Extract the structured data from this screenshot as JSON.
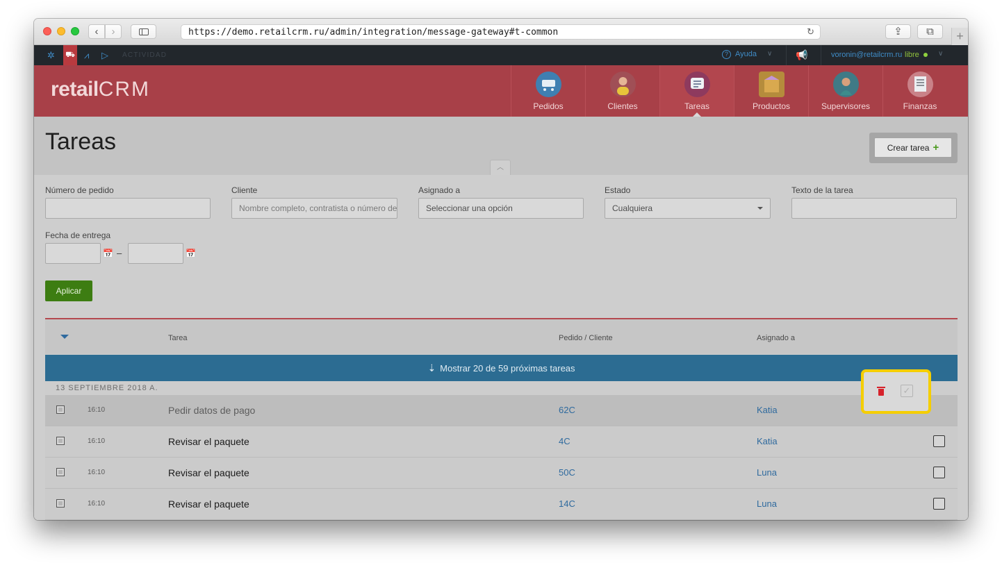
{
  "browser": {
    "url": "https://demo.retailcrm.ru/admin/integration/message-gateway#t-common",
    "new_tab": "+"
  },
  "topbar": {
    "activity": "ACTIVIDAD",
    "help": "Ayuda",
    "user": "voronin@retailcrm.ru",
    "status": "libre"
  },
  "header": {
    "logo_retail": "retail",
    "logo_crm": "CRM",
    "modules": [
      {
        "label": "Pedidos",
        "icon": "cart-icon",
        "color": "#3f7fb1"
      },
      {
        "label": "Clientes",
        "icon": "customer-avatar-icon",
        "color": "#a04f56"
      },
      {
        "label": "Tareas",
        "icon": "tasks-icon",
        "color": "#8e3a5e"
      },
      {
        "label": "Productos",
        "icon": "box-icon",
        "color": "#b58c3c"
      },
      {
        "label": "Supervisores",
        "icon": "manager-avatar-icon",
        "color": "#3f7a86"
      },
      {
        "label": "Finanzas",
        "icon": "finance-icon",
        "color": "#c98288"
      }
    ]
  },
  "page": {
    "title": "Tareas",
    "create_button": "Crear tarea"
  },
  "filters": {
    "order_number_label": "Número de pedido",
    "client_label": "Cliente",
    "client_placeholder": "Nombre completo, contratista o número de",
    "assigned_label": "Asignado a",
    "assigned_value": "Seleccionar una opción",
    "state_label": "Estado",
    "state_value": "Cualquiera",
    "task_text_label": "Texto de la tarea",
    "delivery_date_label": "Fecha de entrega",
    "date_separator": "–",
    "apply_button": "Aplicar"
  },
  "table": {
    "columns": [
      "Tarea",
      "Pedido / Cliente",
      "Asignado a"
    ],
    "show_more": "Mostrar 20 de 59 próximas tareas",
    "date_group": "13 SEPTIEMBRE 2018 A.",
    "rows": [
      {
        "time": "16:10",
        "task": "Pedir datos de pago",
        "order": "62C",
        "assigned": "Katia"
      },
      {
        "time": "16:10",
        "task": "Revisar el paquete",
        "order": "4C",
        "assigned": "Katia"
      },
      {
        "time": "16:10",
        "task": "Revisar el paquete",
        "order": "50C",
        "assigned": "Luna"
      },
      {
        "time": "16:10",
        "task": "Revisar el paquete",
        "order": "14C",
        "assigned": "Luna"
      }
    ]
  },
  "colors": {
    "brand_red": "#a84048",
    "link_blue": "#2f6a9e",
    "apply_green": "#3d7d12",
    "highlight_yellow": "#f5ce00"
  }
}
